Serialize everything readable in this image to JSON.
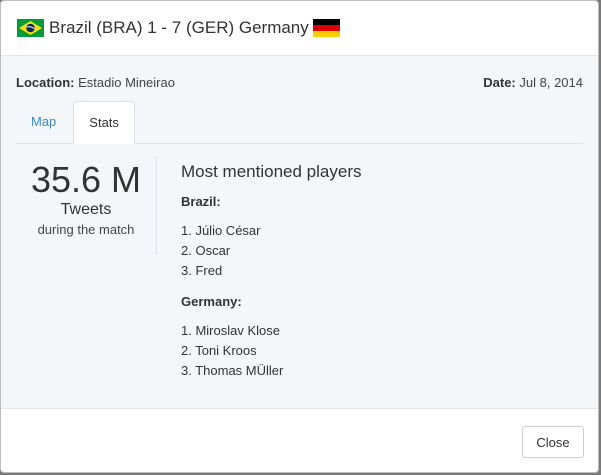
{
  "header": {
    "home_flag_icon": "brazil-flag-icon",
    "title": "Brazil (BRA) 1 - 7 (GER) Germany",
    "away_flag_icon": "germany-flag-icon"
  },
  "meta": {
    "location_label": "Location:",
    "location_value": "Estadio Mineirao",
    "date_label": "Date:",
    "date_value": "Jul 8, 2014"
  },
  "tabs": [
    {
      "label": "Map",
      "active": false
    },
    {
      "label": "Stats",
      "active": true
    }
  ],
  "stats": {
    "tweet_count": "35.6 M",
    "unit": "Tweets",
    "caption": "during the match"
  },
  "players": {
    "title": "Most mentioned players",
    "teams": [
      {
        "label": "Brazil:",
        "items": [
          "1. Júlio César",
          "2. Oscar",
          "3. Fred"
        ]
      },
      {
        "label": "Germany:",
        "items": [
          "1. Miroslav Klose",
          "2. Toni Kroos",
          "3. Thomas MÜller"
        ]
      }
    ]
  },
  "footer": {
    "close_label": "Close"
  },
  "colors": {
    "link": "#3a8ac8",
    "body_bg": "#f3f7fa",
    "brazil_green": "#009b3a",
    "brazil_yellow": "#fedf00",
    "brazil_blue": "#002776",
    "germany_black": "#000000",
    "germany_red": "#dd0000",
    "germany_gold": "#ffce00"
  }
}
